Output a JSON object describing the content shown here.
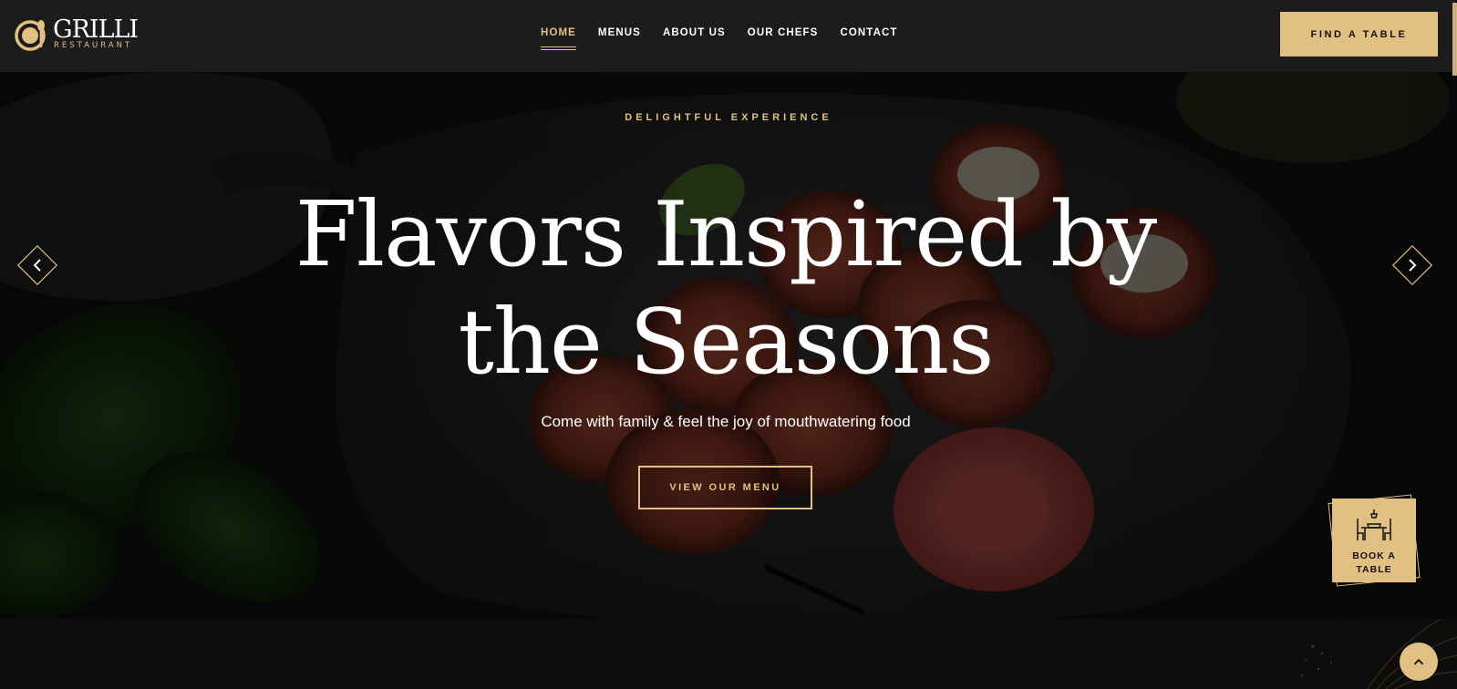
{
  "brand": {
    "name": "GRILLI",
    "tagline": "RESTAURANT",
    "icon": "cup-spoon-logo-icon"
  },
  "nav": {
    "items": [
      {
        "label": "HOME",
        "active": true
      },
      {
        "label": "MENUS",
        "active": false
      },
      {
        "label": "ABOUT US",
        "active": false
      },
      {
        "label": "OUR CHEFS",
        "active": false
      },
      {
        "label": "CONTACT",
        "active": false
      }
    ],
    "cta_label": "FIND A TABLE"
  },
  "hero": {
    "eyebrow": "DELIGHTFUL EXPERIENCE",
    "headline_line1": "Flavors Inspired by",
    "headline_line2": "the Seasons",
    "subtitle": "Come with family & feel the joy of mouthwatering food",
    "button_label": "VIEW OUR MENU",
    "prev_icon": "chevron-left-icon",
    "next_icon": "chevron-right-icon"
  },
  "book_card": {
    "icon": "dining-table-icon",
    "label": "BOOK A TABLE"
  },
  "back_to_top": {
    "icon": "chevron-up-icon"
  },
  "colors": {
    "accent": "#e2c084",
    "header_bg": "#1c1c1d",
    "page_bg": "#0e0d0c",
    "text": "#ffffff"
  }
}
